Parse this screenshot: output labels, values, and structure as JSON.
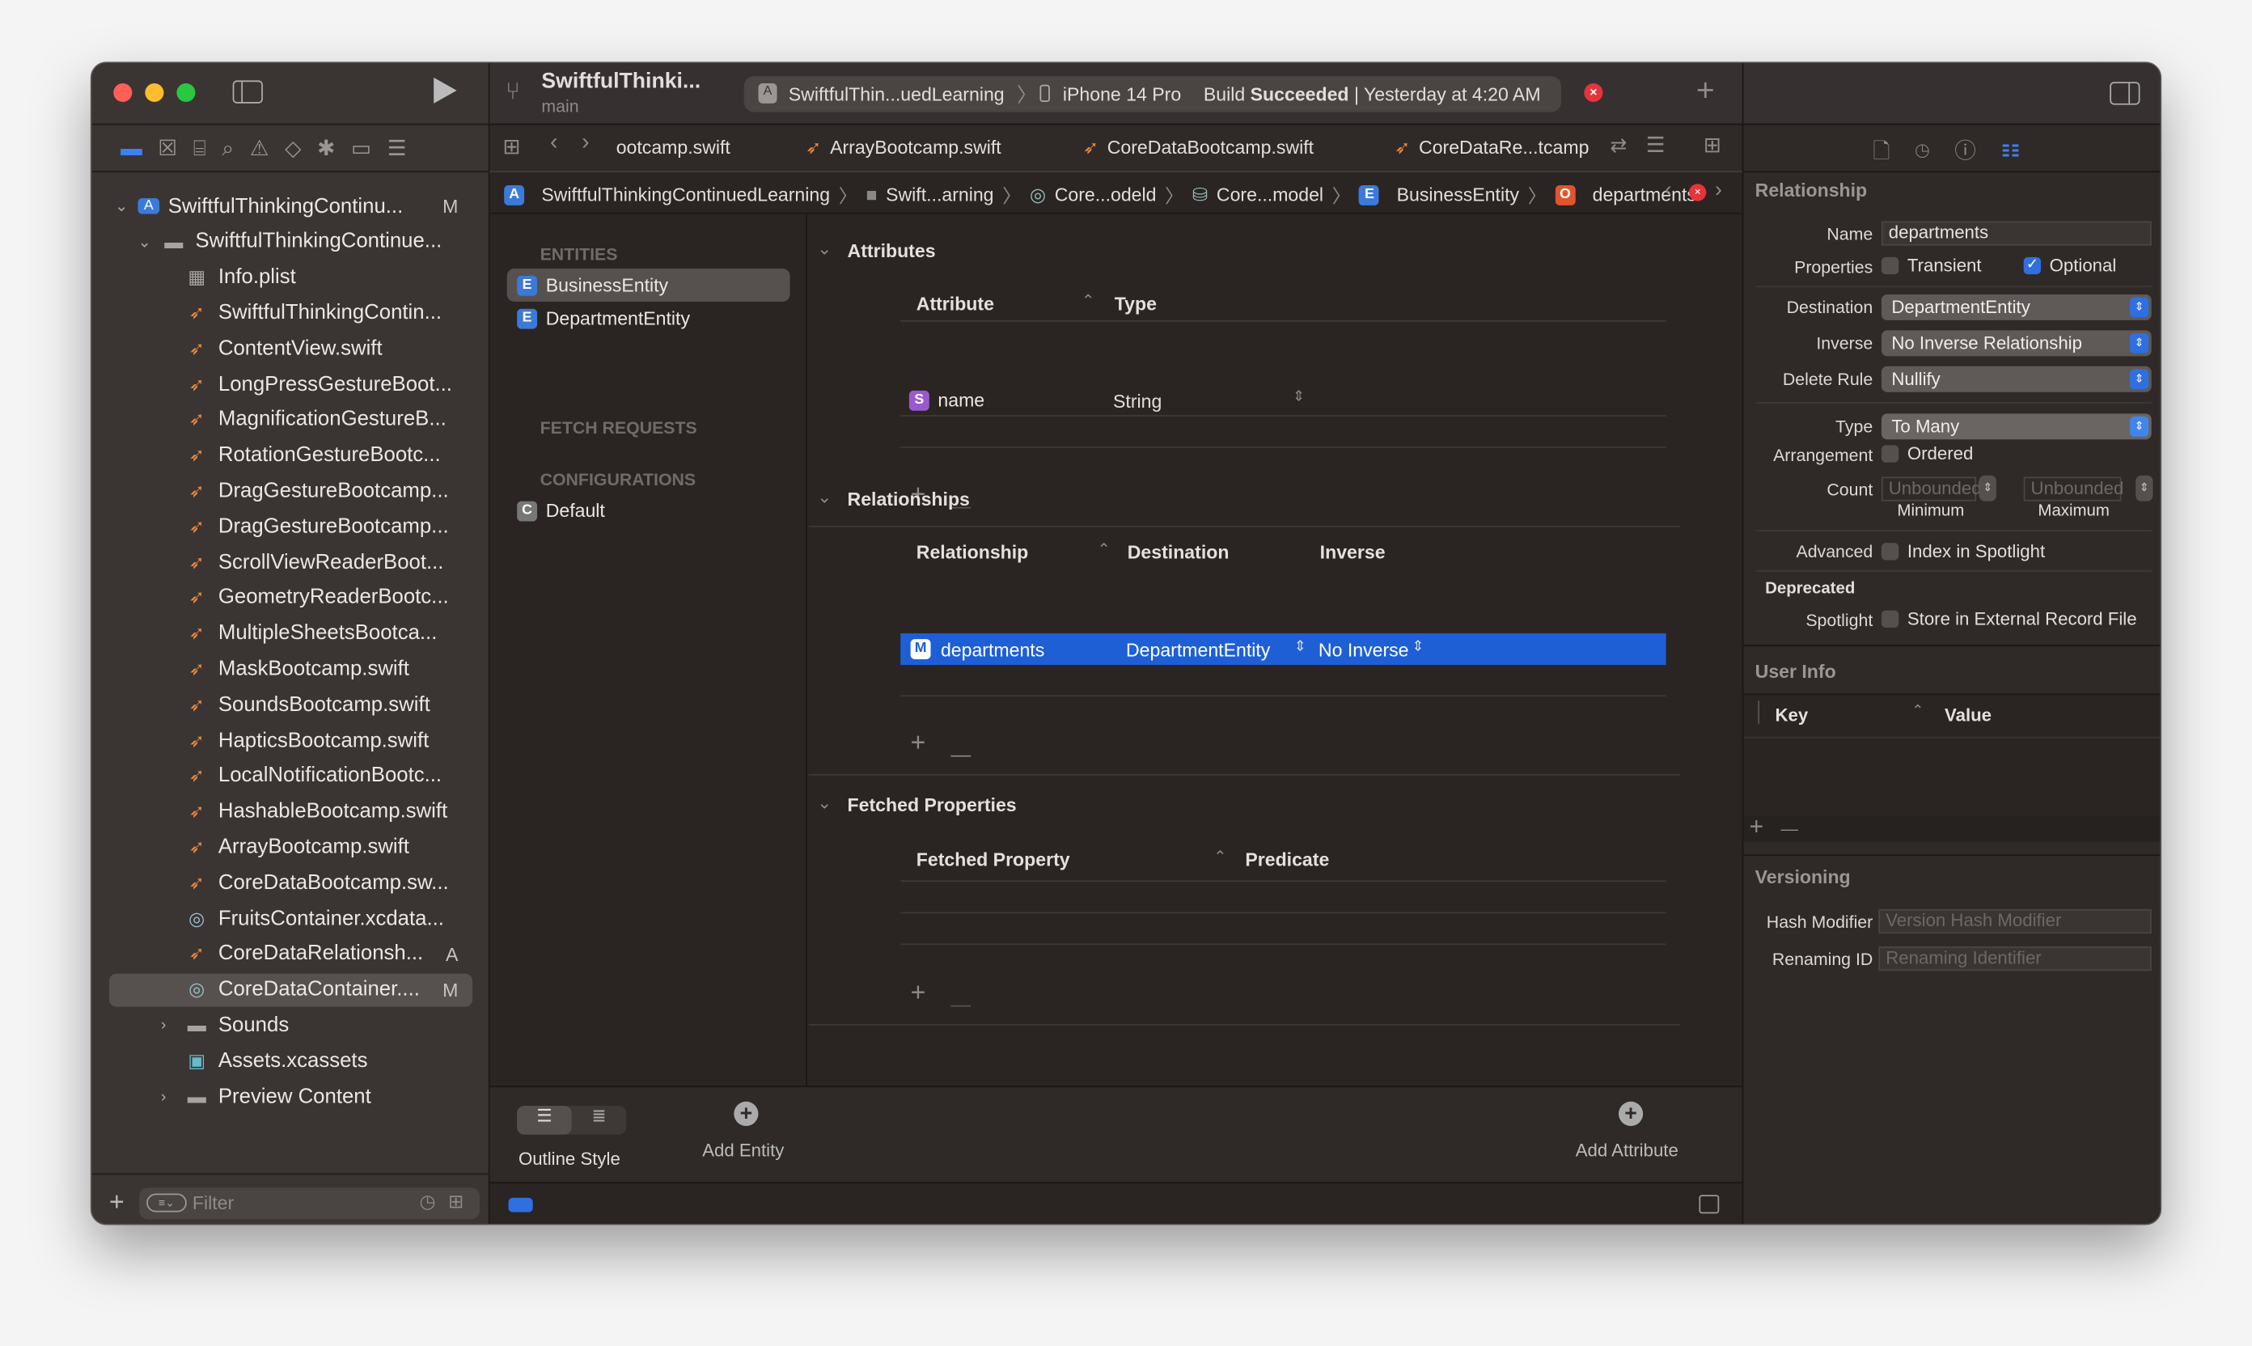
{
  "toolbar": {
    "project_title": "SwiftfulThinki...",
    "branch": "main",
    "scheme": "SwiftfulThin...uedLearning",
    "device": "iPhone 14 Pro",
    "build_status_prefix": "Build",
    "build_status": "Succeeded",
    "build_time": "| Yesterday at 4:20 AM"
  },
  "tabs": [
    "ootcamp.swift",
    "ArrayBootcamp.swift",
    "CoreDataBootcamp.swift",
    "CoreDataRe...tcamp"
  ],
  "breadcrumb": [
    "SwiftfulThinkingContinuedLearning",
    "Swift...arning",
    "Core...odeld",
    "Core...model",
    "BusinessEntity",
    "departments"
  ],
  "navigator": {
    "filter_placeholder": "Filter",
    "items": [
      {
        "label": "SwiftfulThinkingContinu...",
        "kind": "project",
        "level": 0,
        "badge": "M",
        "chevron": "down"
      },
      {
        "label": "SwiftfulThinkingContinue...",
        "kind": "folder",
        "level": 1,
        "chevron": "down"
      },
      {
        "label": "Info.plist",
        "kind": "plist",
        "level": 2
      },
      {
        "label": "SwiftfulThinkingContin...",
        "kind": "swift",
        "level": 2
      },
      {
        "label": "ContentView.swift",
        "kind": "swift",
        "level": 2
      },
      {
        "label": "LongPressGestureBoot...",
        "kind": "swift",
        "level": 2
      },
      {
        "label": "MagnificationGestureB...",
        "kind": "swift",
        "level": 2
      },
      {
        "label": "RotationGestureBootc...",
        "kind": "swift",
        "level": 2
      },
      {
        "label": "DragGestureBootcamp...",
        "kind": "swift",
        "level": 2
      },
      {
        "label": "DragGestureBootcamp...",
        "kind": "swift",
        "level": 2
      },
      {
        "label": "ScrollViewReaderBoot...",
        "kind": "swift",
        "level": 2
      },
      {
        "label": "GeometryReaderBootc...",
        "kind": "swift",
        "level": 2
      },
      {
        "label": "MultipleSheetsBootca...",
        "kind": "swift",
        "level": 2
      },
      {
        "label": "MaskBootcamp.swift",
        "kind": "swift",
        "level": 2
      },
      {
        "label": "SoundsBootcamp.swift",
        "kind": "swift",
        "level": 2
      },
      {
        "label": "HapticsBootcamp.swift",
        "kind": "swift",
        "level": 2
      },
      {
        "label": "LocalNotificationBootc...",
        "kind": "swift",
        "level": 2
      },
      {
        "label": "HashableBootcamp.swift",
        "kind": "swift",
        "level": 2
      },
      {
        "label": "ArrayBootcamp.swift",
        "kind": "swift",
        "level": 2
      },
      {
        "label": "CoreDataBootcamp.sw...",
        "kind": "swift",
        "level": 2
      },
      {
        "label": "FruitsContainer.xcdata...",
        "kind": "datamodel",
        "level": 2
      },
      {
        "label": "CoreDataRelationsh...",
        "kind": "swift",
        "level": 2,
        "badge": "A"
      },
      {
        "label": "CoreDataContainer....",
        "kind": "datamodel",
        "level": 2,
        "badge": "M",
        "selected": true
      },
      {
        "label": "Sounds",
        "kind": "folder",
        "level": 2,
        "chevron": "right"
      },
      {
        "label": "Assets.xcassets",
        "kind": "assets",
        "level": 2
      },
      {
        "label": "Preview Content",
        "kind": "folder",
        "level": 2,
        "chevron": "right"
      }
    ]
  },
  "entity_list": {
    "entities_header": "ENTITIES",
    "entities": [
      "BusinessEntity",
      "DepartmentEntity"
    ],
    "fetch_header": "FETCH REQUESTS",
    "config_header": "CONFIGURATIONS",
    "configs": [
      "Default"
    ]
  },
  "attributes": {
    "title": "Attributes",
    "col_attribute": "Attribute",
    "col_type": "Type",
    "rows": [
      {
        "badge": "S",
        "name": "name",
        "type": "String"
      }
    ]
  },
  "relationships": {
    "title": "Relationships",
    "col_relationship": "Relationship",
    "col_destination": "Destination",
    "col_inverse": "Inverse",
    "rows": [
      {
        "badge": "M",
        "name": "departments",
        "destination": "DepartmentEntity",
        "inverse": "No Inverse"
      }
    ]
  },
  "fetched": {
    "title": "Fetched Properties",
    "col_property": "Fetched Property",
    "col_predicate": "Predicate"
  },
  "bottom_bar": {
    "outline_style": "Outline Style",
    "add_entity": "Add Entity",
    "add_attribute": "Add Attribute"
  },
  "inspector": {
    "title": "Relationship",
    "name_label": "Name",
    "name_value": "departments",
    "properties_label": "Properties",
    "transient": "Transient",
    "optional": "Optional",
    "transient_checked": false,
    "optional_checked": true,
    "destination_label": "Destination",
    "destination_value": "DepartmentEntity",
    "inverse_label": "Inverse",
    "inverse_value": "No Inverse Relationship",
    "delete_rule_label": "Delete Rule",
    "delete_rule_value": "Nullify",
    "type_label": "Type",
    "type_value": "To Many",
    "arrangement_label": "Arrangement",
    "ordered": "Ordered",
    "count_label": "Count",
    "min_placeholder": "Unbounded",
    "max_placeholder": "Unbounded",
    "minimum": "Minimum",
    "maximum": "Maximum",
    "advanced_label": "Advanced",
    "index_spotlight": "Index in Spotlight",
    "deprecated_label": "Deprecated",
    "spotlight_label": "Spotlight",
    "store_external": "Store in External Record File",
    "user_info_title": "User Info",
    "key_col": "Key",
    "value_col": "Value",
    "versioning_title": "Versioning",
    "hash_label": "Hash Modifier",
    "hash_placeholder": "Version Hash Modifier",
    "renaming_label": "Renaming ID",
    "renaming_placeholder": "Renaming Identifier"
  },
  "colors": {
    "accent": "#2f6fe0",
    "swift": "#f0883e",
    "error": "#e5343c"
  }
}
